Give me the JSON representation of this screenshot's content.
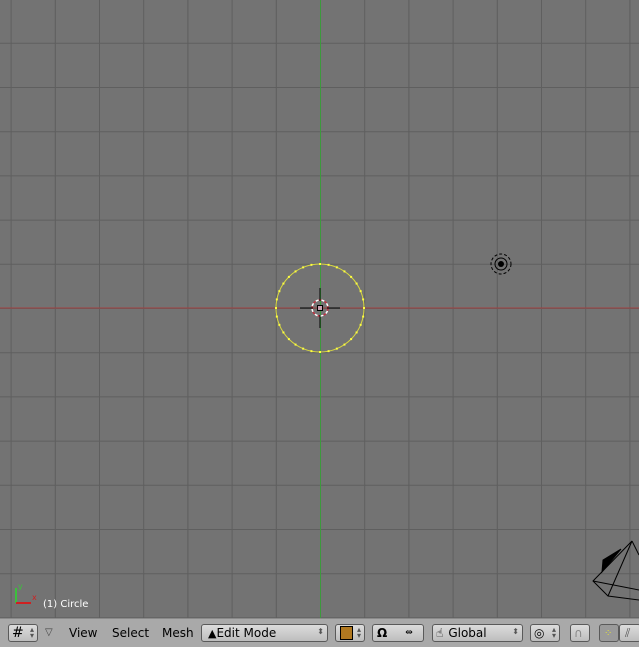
{
  "viewport": {
    "object_label": "(1) Circle",
    "axis_labels": {
      "x": "x",
      "y": "y"
    },
    "colors": {
      "background": "#737373",
      "grid": "#5f5f5f",
      "x_axis": "#a04040",
      "y_axis": "#3c9a3c",
      "selected_vertices": "#ffff40"
    }
  },
  "toolbar": {
    "editor_type_icon": "grid-icon",
    "menus": [
      "View",
      "Select",
      "Mesh"
    ],
    "mode": "Edit Mode",
    "orientation": "Global",
    "icons": [
      "draw-type-icon",
      "pivot-icon",
      "layers-icon",
      "hand-manipulator-icon",
      "proportional-edit-icon",
      "snap-magnet-icon",
      "vertex-select-icon",
      "edge-select-icon"
    ]
  }
}
